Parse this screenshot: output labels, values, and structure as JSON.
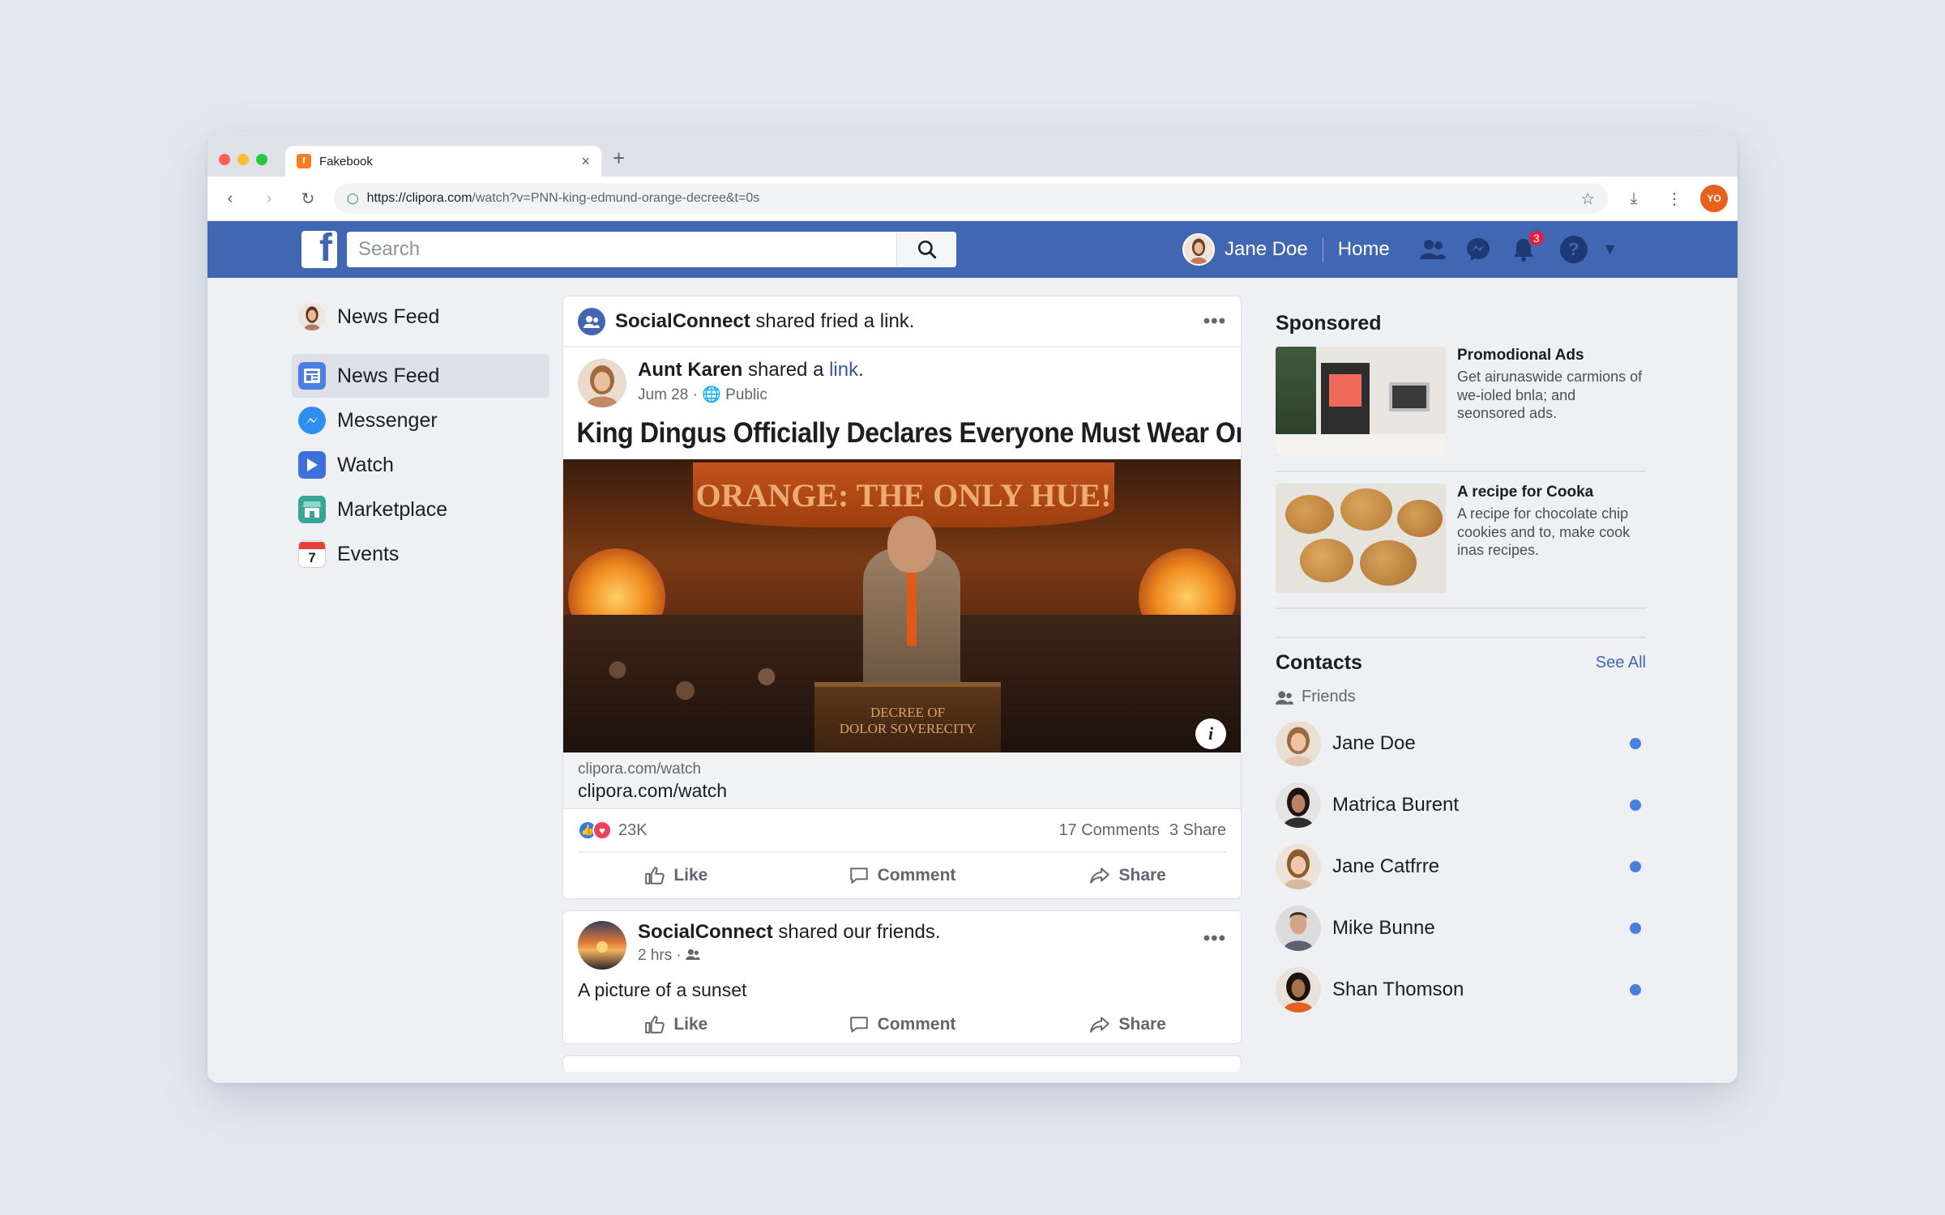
{
  "browser": {
    "tab_title": "Fakebook",
    "tab_favicon": "f",
    "url_host": "https://clipora.com",
    "url_path": "/watch?v=PNN-king-edmund-orange-decree&t=0s",
    "profile_initials": "YO"
  },
  "header": {
    "search_placeholder": "Search",
    "user_name": "Jane Doe",
    "home_label": "Home",
    "notification_count": "3",
    "help_glyph": "?"
  },
  "left_nav": {
    "head_label": "News Feed",
    "items": [
      {
        "label": "News Feed"
      },
      {
        "label": "Messenger"
      },
      {
        "label": "Watch"
      },
      {
        "label": "Marketplace"
      },
      {
        "label": "Events"
      }
    ],
    "events_day": "7"
  },
  "post1": {
    "group_name": "SocialConnect",
    "group_action": " shared fried a link.",
    "author": "Aunt Karen",
    "author_action": " shared a ",
    "author_link": "link",
    "author_period": ".",
    "date": "Jum 28",
    "visibility": "Public",
    "headline": "King Dingus Officially Declares Everyone Must Wear Orange",
    "banner_text": "ORANGE: THE ONLY HUE!",
    "podium_line1": "DECREE OF",
    "podium_line2": "DOLOR SOVERECITY",
    "link_host": "clipora.com/watch",
    "link_title": "clipora.com/watch",
    "reaction_count": "23K",
    "comments": "17 Comments",
    "shares": "3 Share",
    "like": "Like",
    "comment": "Comment",
    "share": "Share"
  },
  "post2": {
    "group_name": "SocialConnect",
    "group_action": " shared our friends.",
    "time": "2 hrs",
    "text": "A picture of a sunset",
    "like": "Like",
    "comment": "Comment",
    "share": "Share"
  },
  "sponsored": {
    "title": "Sponsored",
    "ads": [
      {
        "title": "Promodional Ads",
        "desc": "Get airunaswide carmions of we-ioled bnla; and seonsored ads."
      },
      {
        "title": "A recipe for Cooka",
        "desc": "A recipe for chocolate chip cookies and to, make cook inas recipes."
      }
    ]
  },
  "contacts": {
    "title": "Contacts",
    "see_all": "See All",
    "subtitle": "Friends",
    "people": [
      {
        "name": "Jane Doe"
      },
      {
        "name": "Matrica Burent"
      },
      {
        "name": "Jane Catfrre"
      },
      {
        "name": "Mike Bunne"
      },
      {
        "name": "Shan Thomson"
      }
    ]
  },
  "colors": {
    "fb_blue": "#4267b2",
    "online": "#4a7fe0",
    "notification": "#e41e3f"
  }
}
